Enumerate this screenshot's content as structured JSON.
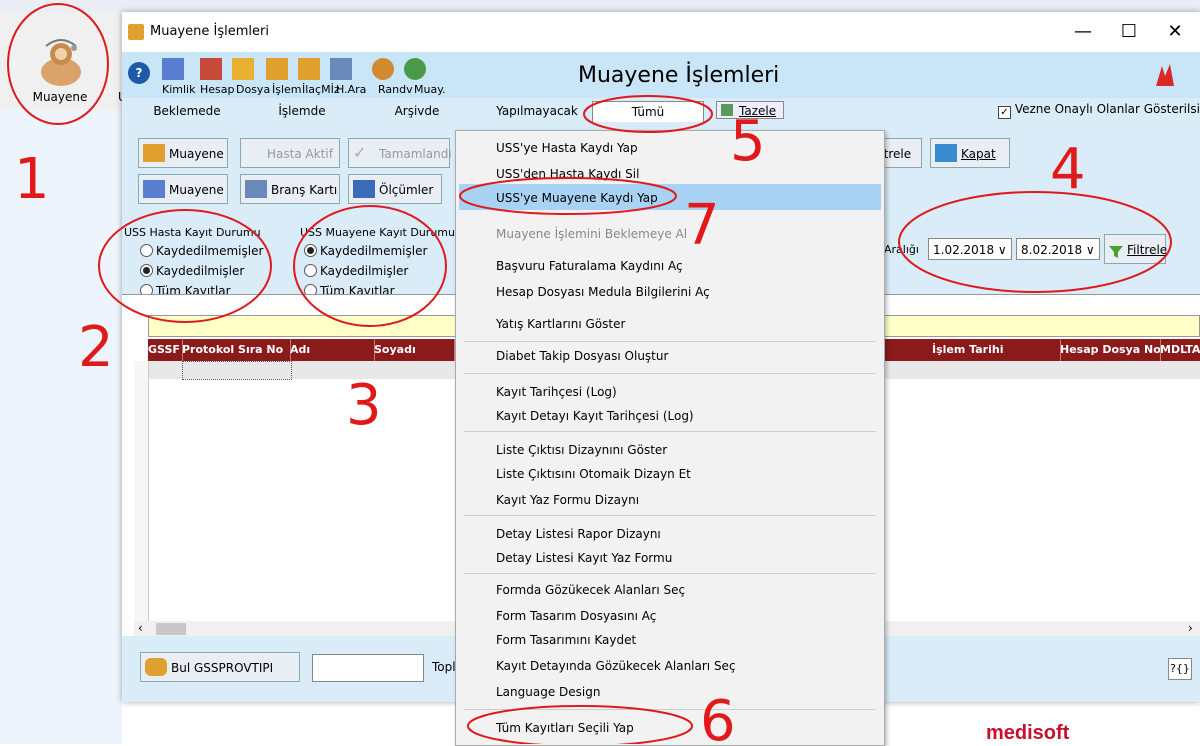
{
  "launcher": {
    "label": "Muayene",
    "letter": "U"
  },
  "window": {
    "title": "Muayene İşlemleri",
    "heading": "Muayene İşlemleri",
    "controls": [
      "—",
      "☐",
      "✕"
    ]
  },
  "toolbar": {
    "items": [
      "Kimlik",
      "Hesap",
      "Dosya",
      "İşlem",
      "İlaçMİz",
      "H.Ara",
      "Randv",
      "Muay."
    ]
  },
  "tabs": [
    {
      "label": "Beklemede"
    },
    {
      "label": "İşlemde"
    },
    {
      "label": "Arşivde"
    },
    {
      "label": "Yapılmayacak"
    },
    {
      "label": "Tümü",
      "active": true
    }
  ],
  "refresh_label": "Tazele",
  "vezne_checkbox": {
    "label": "Vezne Onaylı Olanlar Gösterilsin",
    "checked": true
  },
  "buttons": {
    "muayene1": "Muayene",
    "hasta_aktif": "Hasta Aktif",
    "tamamlandi": "Tamamlandı",
    "muayene2": "Muayene",
    "brans_karti": "Branş Kartı",
    "olcumler": "Ölçümler",
    "filtrele_partial": "iltrele",
    "kapat": "Kapat",
    "filtrele": "Filtrele"
  },
  "uss_hasta": {
    "title": "USS Hasta Kayıt Durumu",
    "options": [
      "Kaydedilmemişler",
      "Kaydedilmişler",
      "Tüm Kayıtlar"
    ],
    "selected": 1
  },
  "uss_muayene": {
    "title": "USS Muayene Kayıt Durumu",
    "options": [
      "Kaydedilmemişler",
      "Kaydedilmişler",
      "Tüm Kayıtlar"
    ],
    "selected": 0
  },
  "date_filter": {
    "label": "Aralığı",
    "from": "1.02.2018",
    "to": "8.02.2018"
  },
  "grid": {
    "columns": [
      "GSSF",
      "Protokol Sıra No",
      "Adı",
      "Soyadı",
      "İşlem Tarihi",
      "Hesap Dosya No",
      "MDLTA"
    ]
  },
  "bottom": {
    "find_label": "Bul GSSPROVTIPI",
    "total_label": "Toplar",
    "help_icon": "?{}"
  },
  "brand": "medisoft",
  "context_menu": {
    "items": [
      {
        "label": "USS'ye Hasta Kaydı Yap"
      },
      {
        "label": "USS'den Hasta Kaydı Sil"
      },
      {
        "label": "USS'ye Muayene Kaydı Yap",
        "highlighted": true
      },
      {
        "label": "Muayene İşlemini Beklemeye Al",
        "disabled": true
      },
      {
        "label": "Başvuru Faturalama Kaydını Aç"
      },
      {
        "label": "Hesap Dosyası Medula Bilgilerini Aç"
      },
      {
        "label": "Yatış Kartlarını Göster"
      },
      {
        "label": "Diabet Takip Dosyası Oluştur"
      },
      {
        "label": "Kayıt Tarihçesi (Log)"
      },
      {
        "label": "Kayıt Detayı Kayıt Tarihçesi (Log)"
      },
      {
        "label": "Liste Çıktısı Dizaynını Göster"
      },
      {
        "label": "Liste Çıktısını Otomaik Dizayn Et"
      },
      {
        "label": "Kayıt Yaz Formu Dizaynı"
      },
      {
        "label": "Detay Listesi Rapor Dizaynı"
      },
      {
        "label": "Detay Listesi Kayıt Yaz Formu"
      },
      {
        "label": "Formda Gözükecek Alanları Seç"
      },
      {
        "label": "Form Tasarım Dosyasını Aç"
      },
      {
        "label": "Form Tasarımını Kaydet"
      },
      {
        "label": "Kayıt Detayında Gözükecek Alanları Seç"
      },
      {
        "label": "Language Design"
      },
      {
        "label": "Tüm Kayıtları Seçili Yap"
      }
    ]
  },
  "annotations": [
    "1",
    "2",
    "3",
    "4",
    "5",
    "6",
    "7"
  ],
  "colors": {
    "header_red": "#8b1a1a",
    "panel_blue": "#d9ecf8",
    "toolbar_blue": "#c9e6f8",
    "menu_highlight": "#a9d3f5",
    "ink": "#e0191b"
  }
}
